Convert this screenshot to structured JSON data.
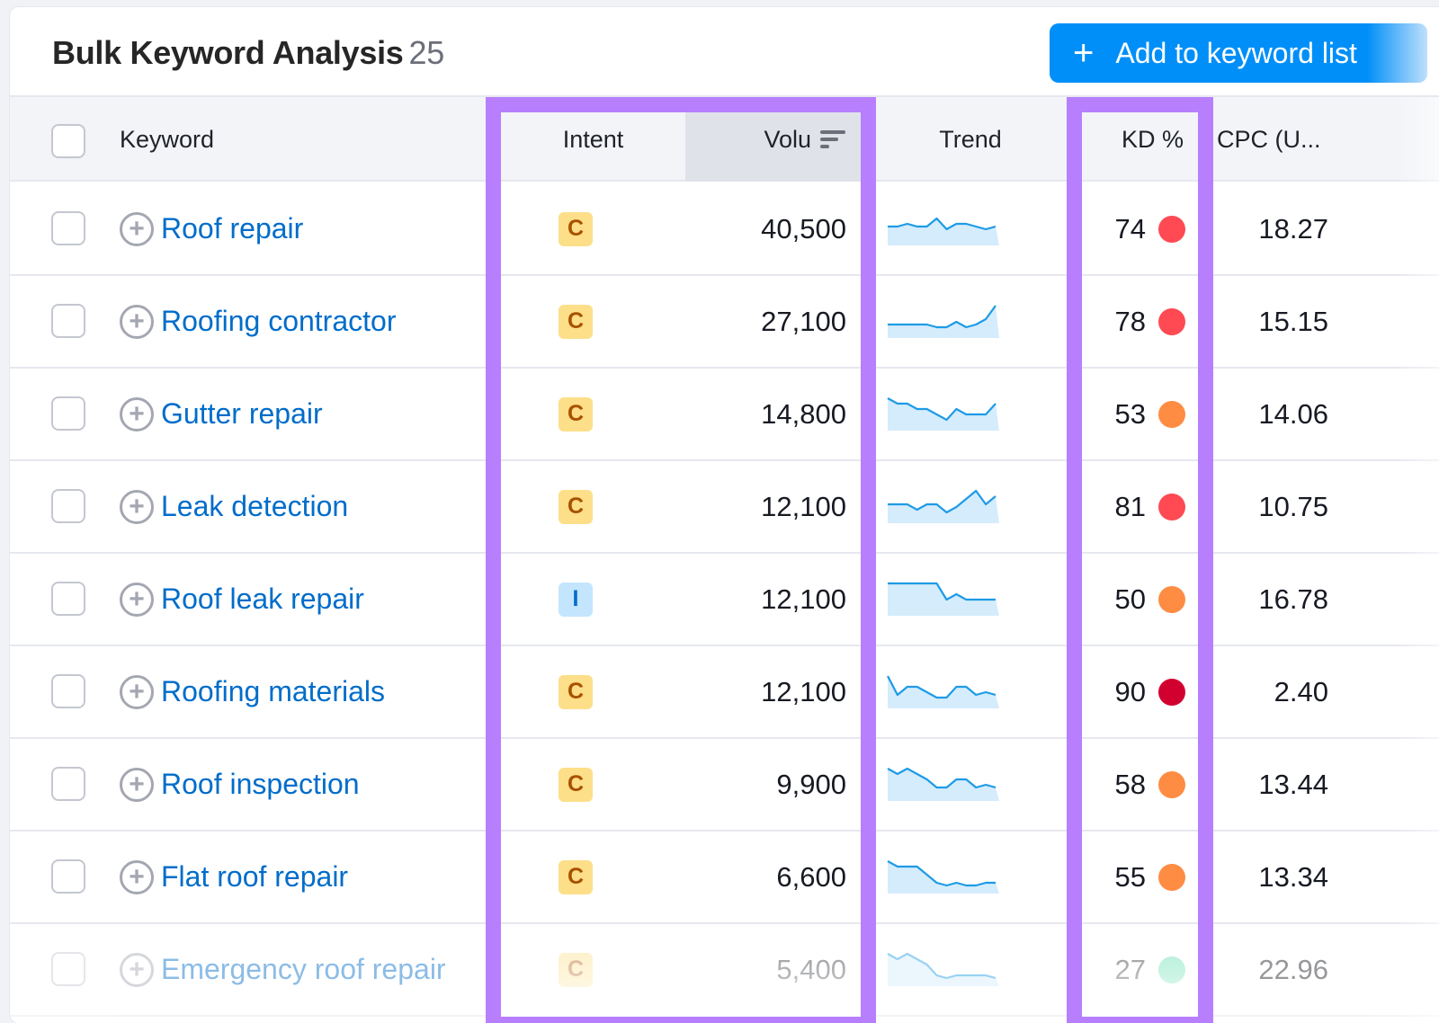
{
  "header": {
    "title": "Bulk Keyword Analysis",
    "count": "25",
    "add_button": {
      "icon": "plus-icon",
      "label": "Add to keyword list"
    }
  },
  "columns": {
    "keyword": "Keyword",
    "intent": "Intent",
    "volume": "Volu",
    "trend": "Trend",
    "kd": "KD %",
    "cpc": "CPC (U..."
  },
  "colors": {
    "accent": "#008ff8",
    "highlight": "#b77ffd",
    "link": "#006dca",
    "trend_line": "#1e9be6",
    "trend_fill": "#d5ecfc",
    "kd_hard": "#ff4953",
    "kd_very_hard": "#d1002f",
    "kd_difficult": "#ff8c43",
    "kd_easy": "#59ddaa"
  },
  "rows": [
    {
      "keyword": "Roof repair",
      "intent": "C",
      "volume": "40,500",
      "kd": "74",
      "kd_level": "hard",
      "cpc": "18.27",
      "trend": [
        5,
        5,
        6,
        5,
        5,
        8,
        4,
        6,
        6,
        5,
        4,
        5
      ]
    },
    {
      "keyword": "Roofing contractor",
      "intent": "C",
      "volume": "27,100",
      "kd": "78",
      "kd_level": "hard",
      "cpc": "15.15",
      "trend": [
        3,
        3,
        3,
        3,
        3,
        2,
        2,
        4,
        2,
        3,
        5,
        10
      ]
    },
    {
      "keyword": "Gutter repair",
      "intent": "C",
      "volume": "14,800",
      "kd": "53",
      "kd_level": "difficult",
      "cpc": "14.06",
      "trend": [
        10,
        8,
        8,
        6,
        6,
        4,
        2,
        6,
        4,
        4,
        4,
        8
      ]
    },
    {
      "keyword": "Leak detection",
      "intent": "C",
      "volume": "12,100",
      "kd": "81",
      "kd_level": "hard",
      "cpc": "10.75",
      "trend": [
        5,
        5,
        5,
        3,
        5,
        5,
        2,
        4,
        7,
        10,
        5,
        8
      ]
    },
    {
      "keyword": "Roof leak repair",
      "intent": "I",
      "volume": "12,100",
      "kd": "50",
      "kd_level": "difficult",
      "cpc": "16.78",
      "trend": [
        10,
        10,
        10,
        10,
        10,
        10,
        4,
        6,
        4,
        4,
        4,
        4
      ]
    },
    {
      "keyword": "Roofing materials",
      "intent": "C",
      "volume": "12,100",
      "kd": "90",
      "kd_level": "very_hard",
      "cpc": "2.40",
      "trend": [
        10,
        3,
        6,
        6,
        4,
        2,
        2,
        6,
        6,
        3,
        4,
        3
      ]
    },
    {
      "keyword": "Roof inspection",
      "intent": "C",
      "volume": "9,900",
      "kd": "58",
      "kd_level": "difficult",
      "cpc": "13.44",
      "trend": [
        10,
        8,
        10,
        8,
        6,
        3,
        3,
        6,
        6,
        3,
        4,
        3
      ]
    },
    {
      "keyword": "Flat roof repair",
      "intent": "C",
      "volume": "6,600",
      "kd": "55",
      "kd_level": "difficult",
      "cpc": "13.34",
      "trend": [
        10,
        8,
        8,
        8,
        5,
        2,
        1,
        2,
        1,
        1,
        2,
        2
      ]
    },
    {
      "keyword": "Emergency roof repair",
      "intent": "C",
      "volume": "5,400",
      "kd": "27",
      "kd_level": "easy",
      "cpc": "22.96",
      "trend": [
        10,
        8,
        10,
        8,
        6,
        2,
        1,
        2,
        2,
        2,
        2,
        1
      ]
    }
  ]
}
